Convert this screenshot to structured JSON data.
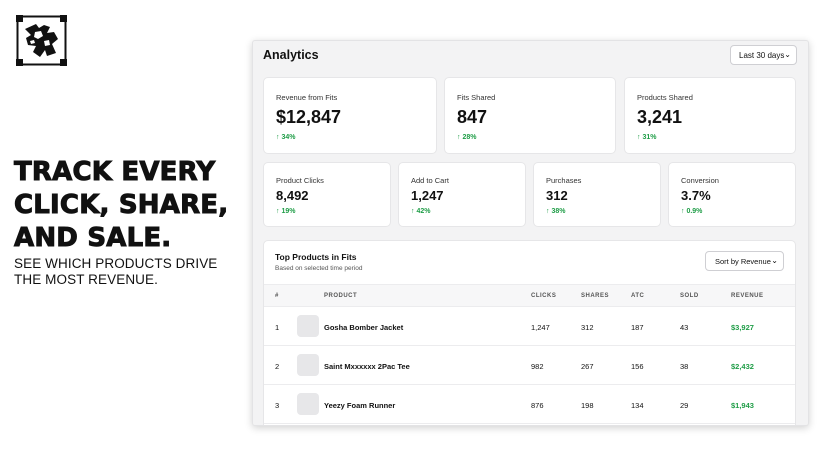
{
  "marketing": {
    "headline": [
      "TRACK EVERY",
      "CLICK, SHARE,",
      "AND SALE."
    ],
    "subline": [
      "SEE WHICH PRODUCTS DRIVE",
      "THE MOST REVENUE."
    ]
  },
  "app": {
    "title": "Analytics",
    "range_select": "Last 30 days"
  },
  "metrics_top": [
    {
      "label": "Revenue from Fits",
      "value": "$12,847",
      "delta": "↑ 34%"
    },
    {
      "label": "Fits Shared",
      "value": "847",
      "delta": "↑ 28%"
    },
    {
      "label": "Products Shared",
      "value": "3,241",
      "delta": "↑ 31%"
    }
  ],
  "metrics_bottom": [
    {
      "label": "Product Clicks",
      "value": "8,492",
      "delta": "↑ 19%"
    },
    {
      "label": "Add to Cart",
      "value": "1,247",
      "delta": "↑ 42%"
    },
    {
      "label": "Purchases",
      "value": "312",
      "delta": "↑ 38%"
    },
    {
      "label": "Conversion",
      "value": "3.7%",
      "delta": "↑ 0.9%"
    }
  ],
  "top_products": {
    "title": "Top Products in Fits",
    "subtitle": "Based on selected time period",
    "sort_select": "Sort by Revenue",
    "columns": [
      "#",
      "PRODUCT",
      "CLICKS",
      "SHARES",
      "ATC",
      "SOLD",
      "REVENUE"
    ],
    "rows": [
      {
        "rank": "1",
        "name": "Gosha Bomber Jacket",
        "clicks": "1,247",
        "shares": "312",
        "atc": "187",
        "sold": "43",
        "revenue": "$3,927"
      },
      {
        "rank": "2",
        "name": "Saint Mxxxxxx 2Pac Tee",
        "clicks": "982",
        "shares": "267",
        "atc": "156",
        "sold": "38",
        "revenue": "$2,432"
      },
      {
        "rank": "3",
        "name": "Yeezy Foam Runner",
        "clicks": "876",
        "shares": "198",
        "atc": "134",
        "sold": "29",
        "revenue": "$1,943"
      }
    ]
  },
  "colors": {
    "positive": "#1f9d47",
    "app_bg": "#f3f3f4"
  }
}
